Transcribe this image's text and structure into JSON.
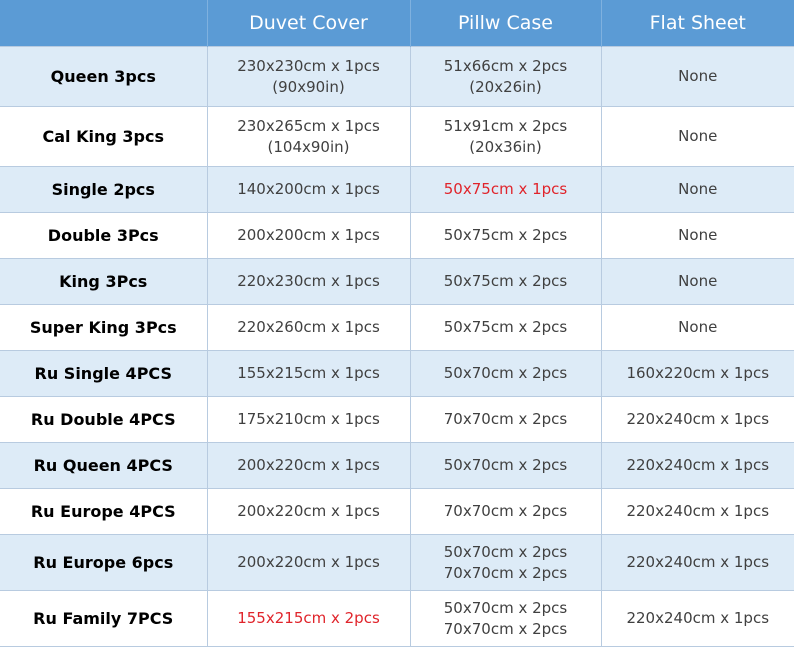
{
  "headers": [
    "",
    "Duvet Cover",
    "Pillw Case",
    "Flat Sheet"
  ],
  "rows": [
    {
      "size": "Queen 3pcs",
      "duvet": [
        "230x230cm x 1pcs",
        "(90x90in)"
      ],
      "pillow": [
        "51x66cm x 2pcs",
        "(20x26in)"
      ],
      "flat": [
        "None"
      ],
      "height": 60
    },
    {
      "size": "Cal King 3pcs",
      "duvet": [
        "230x265cm x 1pcs",
        "(104x90in)"
      ],
      "pillow": [
        "51x91cm x 2pcs",
        "(20x36in)"
      ],
      "flat": [
        "None"
      ],
      "height": 60
    },
    {
      "size": "Single 2pcs",
      "duvet": [
        "140x200cm x 1pcs"
      ],
      "pillow": [
        "50x75cm x 1pcs"
      ],
      "pillow_highlight": true,
      "flat": [
        "None"
      ],
      "height": 46
    },
    {
      "size": "Double 3Pcs",
      "duvet": [
        "200x200cm x 1pcs"
      ],
      "pillow": [
        "50x75cm x 2pcs"
      ],
      "flat": [
        "None"
      ],
      "height": 46
    },
    {
      "size": "King 3Pcs",
      "duvet": [
        "220x230cm x 1pcs"
      ],
      "pillow": [
        "50x75cm x 2pcs"
      ],
      "flat": [
        "None"
      ],
      "height": 46
    },
    {
      "size": "Super King 3Pcs",
      "duvet": [
        "220x260cm x 1pcs"
      ],
      "pillow": [
        "50x75cm x 2pcs"
      ],
      "flat": [
        "None"
      ],
      "height": 46
    },
    {
      "size": "Ru Single 4PCS",
      "duvet": [
        "155x215cm x 1pcs"
      ],
      "pillow": [
        "50x70cm x 2pcs"
      ],
      "flat": [
        "160x220cm x 1pcs"
      ],
      "height": 46
    },
    {
      "size": "Ru Double 4PCS",
      "duvet": [
        "175x210cm x 1pcs"
      ],
      "pillow": [
        "70x70cm x 2pcs"
      ],
      "flat": [
        "220x240cm x 1pcs"
      ],
      "height": 46
    },
    {
      "size": "Ru Queen 4PCS",
      "duvet": [
        "200x220cm x 1pcs"
      ],
      "pillow": [
        "50x70cm x 2pcs"
      ],
      "flat": [
        "220x240cm x 1pcs"
      ],
      "height": 46
    },
    {
      "size": "Ru Europe 4PCS",
      "duvet": [
        "200x220cm x 1pcs"
      ],
      "pillow": [
        "70x70cm x 2pcs"
      ],
      "flat": [
        "220x240cm x 1pcs"
      ],
      "height": 46
    },
    {
      "size": "Ru Europe 6pcs",
      "duvet": [
        "200x220cm x 1pcs"
      ],
      "pillow": [
        "50x70cm x 2pcs",
        "70x70cm x 2pcs"
      ],
      "flat": [
        "220x240cm x 1pcs"
      ],
      "height": 56
    },
    {
      "size": "Ru Family 7PCS",
      "duvet": [
        "155x215cm x 2pcs"
      ],
      "duvet_highlight": true,
      "pillow": [
        "50x70cm x 2pcs",
        "70x70cm x 2pcs"
      ],
      "flat": [
        "220x240cm x 1pcs"
      ],
      "height": 56
    }
  ],
  "colors": {
    "header_bg": "#5b9bd5",
    "row_shade": "#ddebf7",
    "row_white": "#ffffff",
    "highlight_text": "#e0242b",
    "grid_border": "#b8cbe0"
  }
}
